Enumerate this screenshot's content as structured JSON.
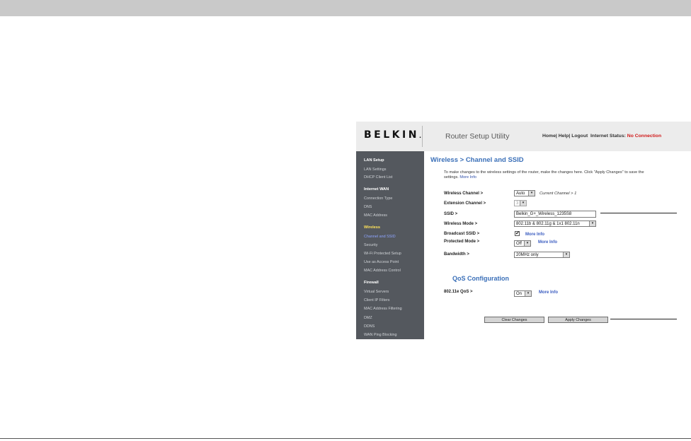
{
  "header": {
    "logo": "BELKIN",
    "logo_mark": ".",
    "app_title": "Router Setup Utility",
    "links": {
      "home": "Home",
      "sep1": "| ",
      "help": "Help",
      "sep2": "| ",
      "logout": "Logout",
      "status_label": "Internet Status:",
      "status_value": "No Connection"
    }
  },
  "sidebar": {
    "lan_setup": "LAN Setup",
    "lan_settings": "LAN Settings",
    "dhcp_client_list": "DHCP Client List",
    "internet_wan": "Internet WAN",
    "connection_type": "Connection Type",
    "dns": "DNS",
    "mac_address": "MAC Address",
    "wireless": "Wireless",
    "channel_ssid": "Channel and SSID",
    "security": "Security",
    "wifi_protected_setup": "Wi-Fi Protected Setup",
    "use_as_access_point": "Use as Access Point",
    "mac_address_control": "MAC Address Control",
    "firewall": "Firewall",
    "virtual_servers": "Virtual Servers",
    "client_ip_filters": "Client IP Filters",
    "mac_address_filtering": "MAC Address Filtering",
    "dmz": "DMZ",
    "ddns": "DDNS",
    "wan_ping_blocking": "WAN Ping Blocking"
  },
  "main": {
    "page_title": "Wireless > Channel and SSID",
    "intro": "To make changes to the wireless settings of the router, make the changes here. Click \"Apply Changes\" to save the settings.",
    "intro_more": "More Info",
    "wireless_channel_label": "Wireless Channel >",
    "wireless_channel_value": "Auto",
    "current_channel": "Current Channel > 1",
    "extension_channel_label": "Extension Channel >",
    "extension_channel_value": "3",
    "ssid_label": "SSID >",
    "ssid_value": "Belkin_G+_Wireless_1235S8",
    "wireless_mode_label": "Wireless Mode >",
    "wireless_mode_value": "802.11b & 802.11g & 1x1 802.11n",
    "broadcast_ssid_label": "Broadcast SSID >",
    "broadcast_checked_mark": "✔",
    "broadcast_more": "More Info",
    "protected_mode_label": "Protected Mode >",
    "protected_mode_value": "Off",
    "protected_more": "More Info",
    "bandwidth_label": "Bandwidth >",
    "bandwidth_value": "20MHz only",
    "qos_title": "QoS Configuration",
    "qos_label": "802.11e QoS >",
    "qos_value": "On",
    "qos_more": "More Info",
    "clear_button": "Clear Changes",
    "apply_button": "Apply Changes",
    "dropdown_arrow": "▾"
  }
}
